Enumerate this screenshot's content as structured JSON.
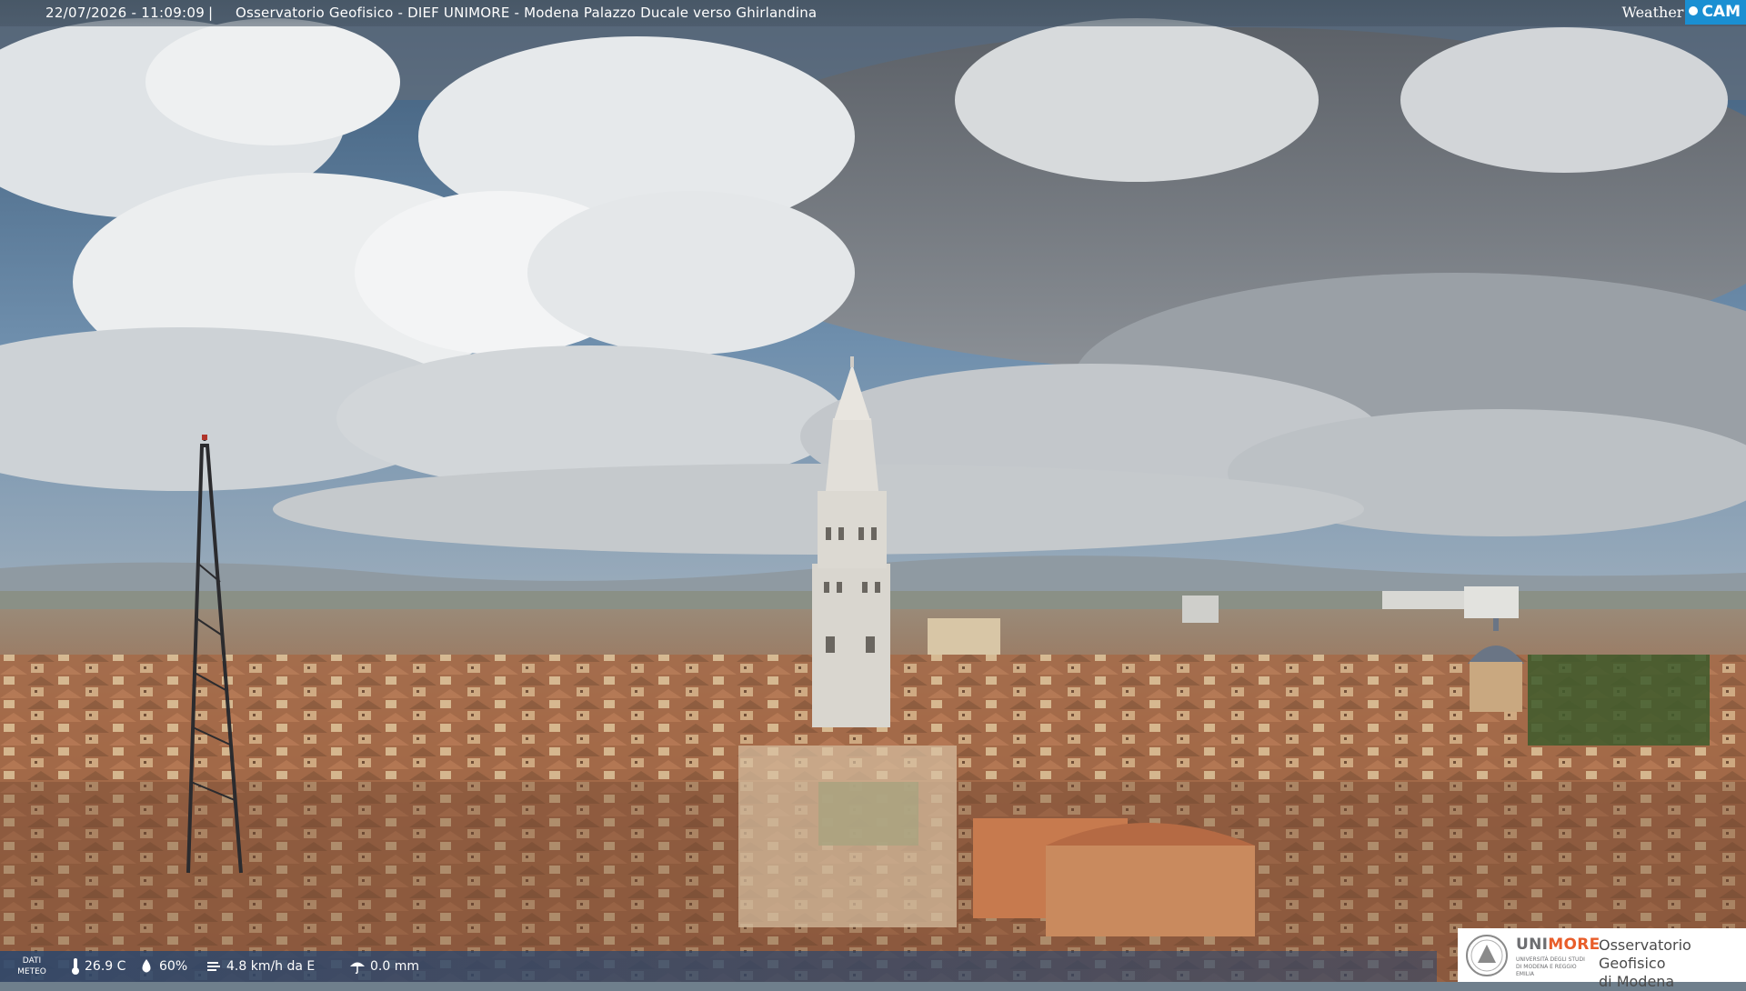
{
  "overlay": {
    "timestamp": "22/07/2026 - 11:09:09",
    "separator": "|",
    "caption": "Osservatorio Geofisico - DIEF UNIMORE - Modena Palazzo Ducale verso Ghirlandina",
    "brand_weather": "Weather",
    "brand_cam": "CAM"
  },
  "meteo": {
    "label_line1": "DATI",
    "label_line2": "METEO",
    "temperature": "26.9 C",
    "humidity": "60%",
    "wind": "4.8 km/h da E",
    "rain": "0.0 mm",
    "icons": [
      "thermometer-icon",
      "humidity-drop-icon",
      "wind-icon",
      "rain-umbrella-icon"
    ]
  },
  "logo": {
    "uni_part1": "UNI",
    "uni_part2": "MORE",
    "uni_sub": "UNIVERSITÀ DEGLI STUDI DI MODENA E REGGIO EMILIA",
    "observatory_line1": "Osservatorio Geofisico",
    "observatory_line2": "di Modena"
  },
  "colors": {
    "brand_blue": "#1a8fd2",
    "unimore_orange": "#e85d2a",
    "meteo_bar": "#284670"
  }
}
